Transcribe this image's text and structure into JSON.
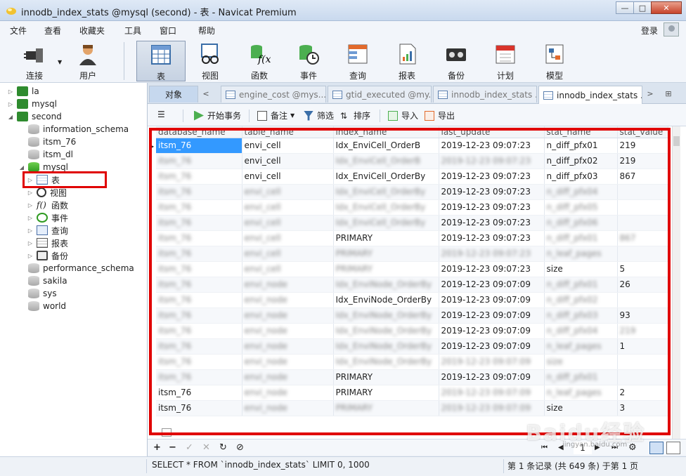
{
  "window": {
    "title": "innodb_index_stats @mysql (second) - 表 - Navicat Premium",
    "minimize": "—",
    "maximize": "□",
    "close": "✕"
  },
  "menu": [
    "文件",
    "查看",
    "收藏夹",
    "工具",
    "窗口",
    "帮助"
  ],
  "login": "登录",
  "toolbar": [
    {
      "label": "连接",
      "icon": "plug-icon"
    },
    {
      "label": "用户",
      "icon": "user-icon"
    },
    {
      "label": "表",
      "icon": "table-icon"
    },
    {
      "label": "视图",
      "icon": "view-icon"
    },
    {
      "label": "函数",
      "icon": "function-icon"
    },
    {
      "label": "事件",
      "icon": "event-icon"
    },
    {
      "label": "查询",
      "icon": "query-icon"
    },
    {
      "label": "报表",
      "icon": "report-icon"
    },
    {
      "label": "备份",
      "icon": "backup-icon"
    },
    {
      "label": "计划",
      "icon": "schedule-icon"
    },
    {
      "label": "模型",
      "icon": "model-icon"
    }
  ],
  "tree": {
    "conn_la": "la",
    "conn_mysql": "mysql",
    "conn_second": "second",
    "db_information_schema": "information_schema",
    "db_itsm_76": "itsm_76",
    "db_itsm_dl": "itsm_dl",
    "db_mysql": "mysql",
    "node_tables": "表",
    "node_views": "视图",
    "node_functions": "函数",
    "node_events": "事件",
    "node_queries": "查询",
    "node_reports": "报表",
    "node_backups": "备份",
    "db_performance_schema": "performance_schema",
    "db_sakila": "sakila",
    "db_sys": "sys",
    "db_world": "world"
  },
  "tabs": {
    "object": "对象",
    "tab1": "engine_cost @mys...",
    "tab2": "gtid_executed @my...",
    "tab3": "innodb_index_stats ...",
    "tab4": "innodb_index_stats ..."
  },
  "subtoolbar": {
    "begin_tx": "开始事务",
    "note": "备注",
    "filter": "筛选",
    "sort": "排序",
    "import": "导入",
    "export": "导出"
  },
  "grid": {
    "columns": [
      "database_name",
      "table_name",
      "index_name",
      "last_update",
      "stat_name",
      "stat_value"
    ],
    "rows": [
      [
        "itsm_76",
        "envi_cell",
        "Idx_EnviCell_OrderB",
        "2019-12-23 09:07:23",
        "n_diff_pfx01",
        "219"
      ],
      [
        "itsm_76",
        "envi_cell",
        "Idx_EnviCell_OrderB",
        "2019-12-23 09:07:23",
        "n_diff_pfx02",
        "219"
      ],
      [
        "itsm_76",
        "envi_cell",
        "Idx_EnviCell_OrderBy",
        "2019-12-23 09:07:23",
        "n_diff_pfx03",
        "867"
      ],
      [
        "itsm_76",
        "envi_cell",
        "Idx_EnviCell_OrderBy",
        "2019-12-23 09:07:23",
        "n_diff_pfx04",
        ""
      ],
      [
        "itsm_76",
        "envi_cell",
        "Idx_EnviCell_OrderBy",
        "2019-12-23 09:07:23",
        "n_diff_pfx05",
        ""
      ],
      [
        "itsm_76",
        "envi_cell",
        "Idx_EnviCell_OrderBy",
        "2019-12-23 09:07:23",
        "n_diff_pfx06",
        ""
      ],
      [
        "itsm_76",
        "envi_cell",
        "PRIMARY",
        "2019-12-23 09:07:23",
        "n_diff_pfx01",
        "867"
      ],
      [
        "itsm_76",
        "envi_cell",
        "PRIMARY",
        "2019-12-23 09:07:23",
        "n_leaf_pages",
        ""
      ],
      [
        "itsm_76",
        "envi_cell",
        "PRIMARY",
        "2019-12-23 09:07:23",
        "size",
        "5"
      ],
      [
        "itsm_76",
        "envi_node",
        "Idx_EnviNode_OrderBy",
        "2019-12-23 09:07:09",
        "n_diff_pfx01",
        "26"
      ],
      [
        "itsm_76",
        "envi_node",
        "Idx_EnviNode_OrderBy",
        "2019-12-23 09:07:09",
        "n_diff_pfx02",
        ""
      ],
      [
        "itsm_76",
        "envi_node",
        "Idx_EnviNode_OrderBy",
        "2019-12-23 09:07:09",
        "n_diff_pfx03",
        "93"
      ],
      [
        "itsm_76",
        "envi_node",
        "Idx_EnviNode_OrderBy",
        "2019-12-23 09:07:09",
        "n_diff_pfx04",
        "219"
      ],
      [
        "itsm_76",
        "envi_node",
        "Idx_EnviNode_OrderBy",
        "2019-12-23 09:07:09",
        "n_leaf_pages",
        "1"
      ],
      [
        "itsm_76",
        "envi_node",
        "Idx_EnviNode_OrderBy",
        "2019-12-23 09:07:09",
        "size",
        ""
      ],
      [
        "itsm_76",
        "envi_node",
        "PRIMARY",
        "2019-12-23 09:07:09",
        "n_diff_pfx01",
        ""
      ],
      [
        "itsm_76",
        "envi_node",
        "PRIMARY",
        "2019-12-23 09:07:09",
        "n_leaf_pages",
        "2"
      ],
      [
        "itsm_76",
        "envi_node",
        "PRIMARY",
        "2019-12-23 09:07:09",
        "size",
        "3"
      ]
    ],
    "clear": [
      [
        0,
        1
      ],
      [
        0,
        2
      ],
      [
        0,
        3
      ],
      [
        0,
        4
      ],
      [
        0,
        5
      ],
      [
        1,
        1
      ],
      [
        1,
        4
      ],
      [
        1,
        5
      ],
      [
        2,
        1
      ],
      [
        2,
        2
      ],
      [
        2,
        3
      ],
      [
        2,
        4
      ],
      [
        2,
        5
      ],
      [
        3,
        3
      ],
      [
        4,
        3
      ],
      [
        5,
        3
      ],
      [
        6,
        2
      ],
      [
        6,
        3
      ],
      [
        8,
        3
      ],
      [
        8,
        4
      ],
      [
        8,
        5
      ],
      [
        9,
        3
      ],
      [
        9,
        5
      ],
      [
        10,
        2
      ],
      [
        10,
        3
      ],
      [
        11,
        3
      ],
      [
        11,
        5
      ],
      [
        12,
        3
      ],
      [
        13,
        3
      ],
      [
        13,
        5
      ],
      [
        15,
        2
      ],
      [
        15,
        3
      ],
      [
        16,
        0
      ],
      [
        16,
        2
      ],
      [
        16,
        5
      ],
      [
        17,
        0
      ],
      [
        17,
        4
      ],
      [
        17,
        5
      ]
    ]
  },
  "navbar": {
    "add": "+",
    "remove": "−",
    "apply": "✓",
    "cancel": "✕",
    "refresh": "↻",
    "stop": "⊘",
    "first": "⏮",
    "prev": "◀",
    "page": "1",
    "next": "▶",
    "last": "⏭",
    "settings": "⚙"
  },
  "status": {
    "sql": "SELECT * FROM `innodb_index_stats` LIMIT 0, 1000",
    "records": "第 1 条记录 (共 649 条) 于第 1 页"
  },
  "watermark": {
    "main": "Baidu经验",
    "sub": "jingyan.baidu.com"
  },
  "colors": {
    "highlight": "#e00000",
    "selection": "#3399ff"
  }
}
